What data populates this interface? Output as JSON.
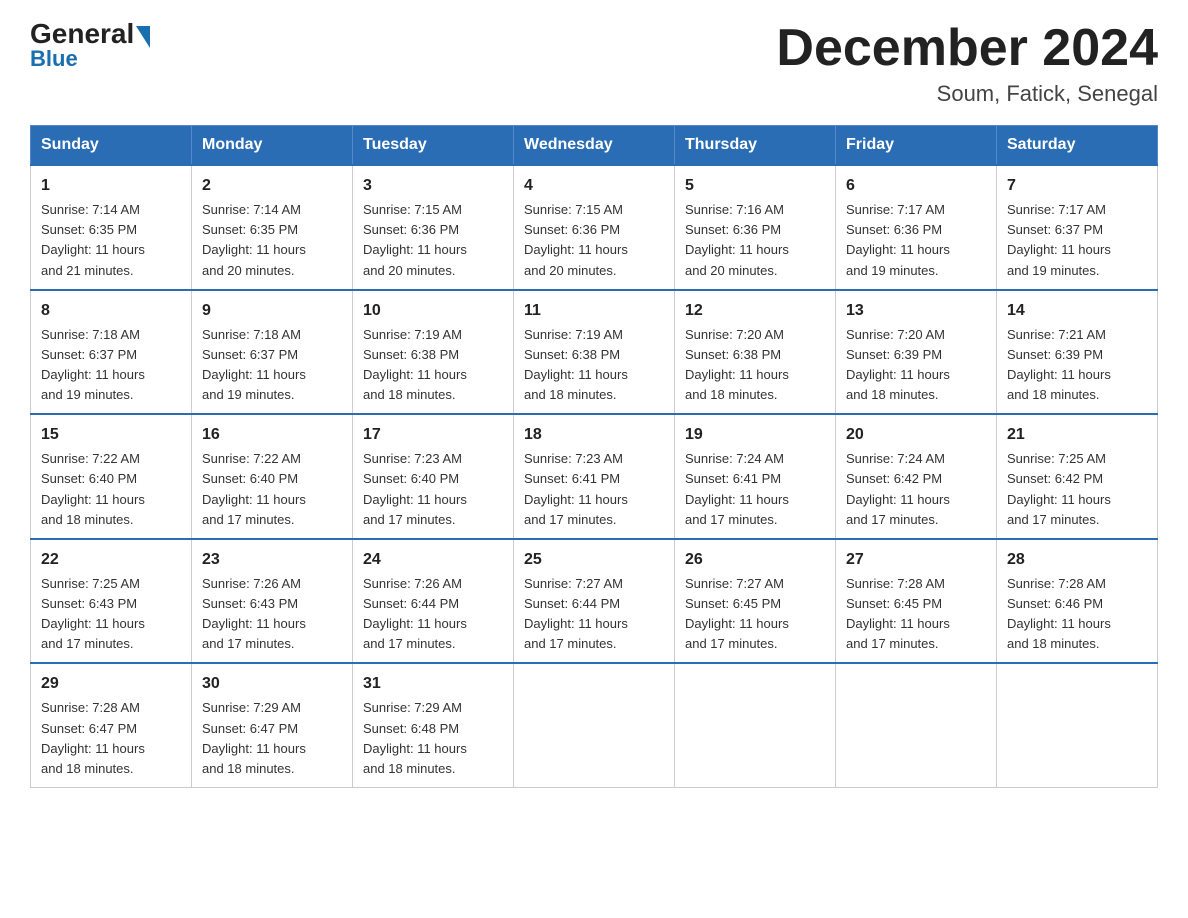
{
  "header": {
    "logo_general": "General",
    "logo_blue": "Blue",
    "month_title": "December 2024",
    "location": "Soum, Fatick, Senegal"
  },
  "weekdays": [
    "Sunday",
    "Monday",
    "Tuesday",
    "Wednesday",
    "Thursday",
    "Friday",
    "Saturday"
  ],
  "weeks": [
    [
      {
        "day": "1",
        "sunrise": "7:14 AM",
        "sunset": "6:35 PM",
        "daylight": "11 hours and 21 minutes."
      },
      {
        "day": "2",
        "sunrise": "7:14 AM",
        "sunset": "6:35 PM",
        "daylight": "11 hours and 20 minutes."
      },
      {
        "day": "3",
        "sunrise": "7:15 AM",
        "sunset": "6:36 PM",
        "daylight": "11 hours and 20 minutes."
      },
      {
        "day": "4",
        "sunrise": "7:15 AM",
        "sunset": "6:36 PM",
        "daylight": "11 hours and 20 minutes."
      },
      {
        "day": "5",
        "sunrise": "7:16 AM",
        "sunset": "6:36 PM",
        "daylight": "11 hours and 20 minutes."
      },
      {
        "day": "6",
        "sunrise": "7:17 AM",
        "sunset": "6:36 PM",
        "daylight": "11 hours and 19 minutes."
      },
      {
        "day": "7",
        "sunrise": "7:17 AM",
        "sunset": "6:37 PM",
        "daylight": "11 hours and 19 minutes."
      }
    ],
    [
      {
        "day": "8",
        "sunrise": "7:18 AM",
        "sunset": "6:37 PM",
        "daylight": "11 hours and 19 minutes."
      },
      {
        "day": "9",
        "sunrise": "7:18 AM",
        "sunset": "6:37 PM",
        "daylight": "11 hours and 19 minutes."
      },
      {
        "day": "10",
        "sunrise": "7:19 AM",
        "sunset": "6:38 PM",
        "daylight": "11 hours and 18 minutes."
      },
      {
        "day": "11",
        "sunrise": "7:19 AM",
        "sunset": "6:38 PM",
        "daylight": "11 hours and 18 minutes."
      },
      {
        "day": "12",
        "sunrise": "7:20 AM",
        "sunset": "6:38 PM",
        "daylight": "11 hours and 18 minutes."
      },
      {
        "day": "13",
        "sunrise": "7:20 AM",
        "sunset": "6:39 PM",
        "daylight": "11 hours and 18 minutes."
      },
      {
        "day": "14",
        "sunrise": "7:21 AM",
        "sunset": "6:39 PM",
        "daylight": "11 hours and 18 minutes."
      }
    ],
    [
      {
        "day": "15",
        "sunrise": "7:22 AM",
        "sunset": "6:40 PM",
        "daylight": "11 hours and 18 minutes."
      },
      {
        "day": "16",
        "sunrise": "7:22 AM",
        "sunset": "6:40 PM",
        "daylight": "11 hours and 17 minutes."
      },
      {
        "day": "17",
        "sunrise": "7:23 AM",
        "sunset": "6:40 PM",
        "daylight": "11 hours and 17 minutes."
      },
      {
        "day": "18",
        "sunrise": "7:23 AM",
        "sunset": "6:41 PM",
        "daylight": "11 hours and 17 minutes."
      },
      {
        "day": "19",
        "sunrise": "7:24 AM",
        "sunset": "6:41 PM",
        "daylight": "11 hours and 17 minutes."
      },
      {
        "day": "20",
        "sunrise": "7:24 AM",
        "sunset": "6:42 PM",
        "daylight": "11 hours and 17 minutes."
      },
      {
        "day": "21",
        "sunrise": "7:25 AM",
        "sunset": "6:42 PM",
        "daylight": "11 hours and 17 minutes."
      }
    ],
    [
      {
        "day": "22",
        "sunrise": "7:25 AM",
        "sunset": "6:43 PM",
        "daylight": "11 hours and 17 minutes."
      },
      {
        "day": "23",
        "sunrise": "7:26 AM",
        "sunset": "6:43 PM",
        "daylight": "11 hours and 17 minutes."
      },
      {
        "day": "24",
        "sunrise": "7:26 AM",
        "sunset": "6:44 PM",
        "daylight": "11 hours and 17 minutes."
      },
      {
        "day": "25",
        "sunrise": "7:27 AM",
        "sunset": "6:44 PM",
        "daylight": "11 hours and 17 minutes."
      },
      {
        "day": "26",
        "sunrise": "7:27 AM",
        "sunset": "6:45 PM",
        "daylight": "11 hours and 17 minutes."
      },
      {
        "day": "27",
        "sunrise": "7:28 AM",
        "sunset": "6:45 PM",
        "daylight": "11 hours and 17 minutes."
      },
      {
        "day": "28",
        "sunrise": "7:28 AM",
        "sunset": "6:46 PM",
        "daylight": "11 hours and 18 minutes."
      }
    ],
    [
      {
        "day": "29",
        "sunrise": "7:28 AM",
        "sunset": "6:47 PM",
        "daylight": "11 hours and 18 minutes."
      },
      {
        "day": "30",
        "sunrise": "7:29 AM",
        "sunset": "6:47 PM",
        "daylight": "11 hours and 18 minutes."
      },
      {
        "day": "31",
        "sunrise": "7:29 AM",
        "sunset": "6:48 PM",
        "daylight": "11 hours and 18 minutes."
      },
      null,
      null,
      null,
      null
    ]
  ],
  "labels": {
    "sunrise": "Sunrise:",
    "sunset": "Sunset:",
    "daylight": "Daylight:"
  }
}
